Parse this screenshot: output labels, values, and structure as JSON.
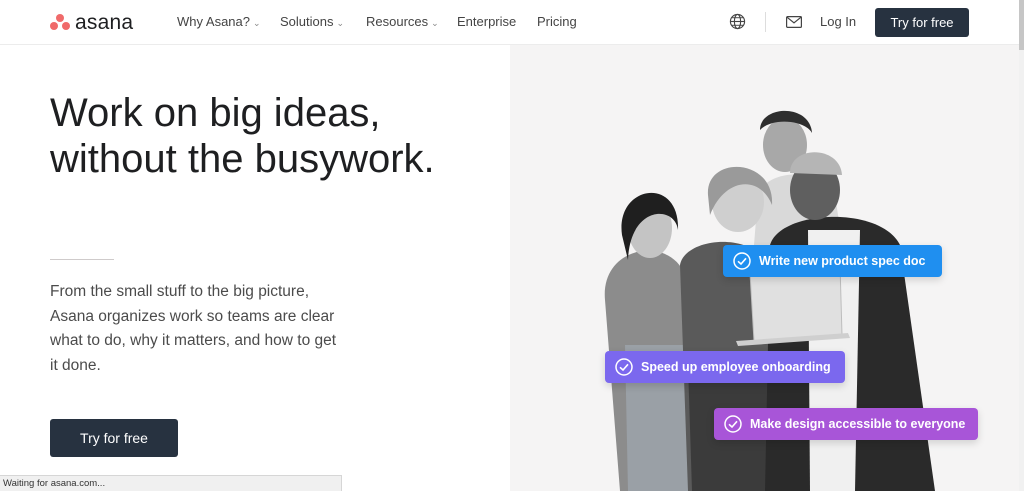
{
  "brand": {
    "name": "asana",
    "logo_color": "#f06a6a"
  },
  "nav": {
    "items": [
      {
        "label": "Why Asana?",
        "has_dropdown": true
      },
      {
        "label": "Solutions",
        "has_dropdown": true
      },
      {
        "label": "Resources",
        "has_dropdown": true
      },
      {
        "label": "Enterprise",
        "has_dropdown": false
      },
      {
        "label": "Pricing",
        "has_dropdown": false
      }
    ],
    "login_label": "Log In",
    "cta_label": "Try for free",
    "icons": [
      "globe-icon",
      "mail-icon"
    ]
  },
  "hero": {
    "title_line1": "Work on big ideas,",
    "title_line2": "without the busywork.",
    "body": "From the small stuff to the big picture, Asana organizes work so teams are clear what to do, why it matters, and how to get it done.",
    "cta_label": "Try for free"
  },
  "tasks": [
    {
      "label": "Write new product spec doc",
      "color": "#1f8ff0"
    },
    {
      "label": "Speed up employee onboarding",
      "color": "#7b68ee"
    },
    {
      "label": "Make design accessible to everyone",
      "color": "#a855d8"
    }
  ],
  "status_bar": {
    "text": "Waiting for asana.com..."
  },
  "colors": {
    "dark_button": "#273240",
    "text": "#1e1f21"
  }
}
